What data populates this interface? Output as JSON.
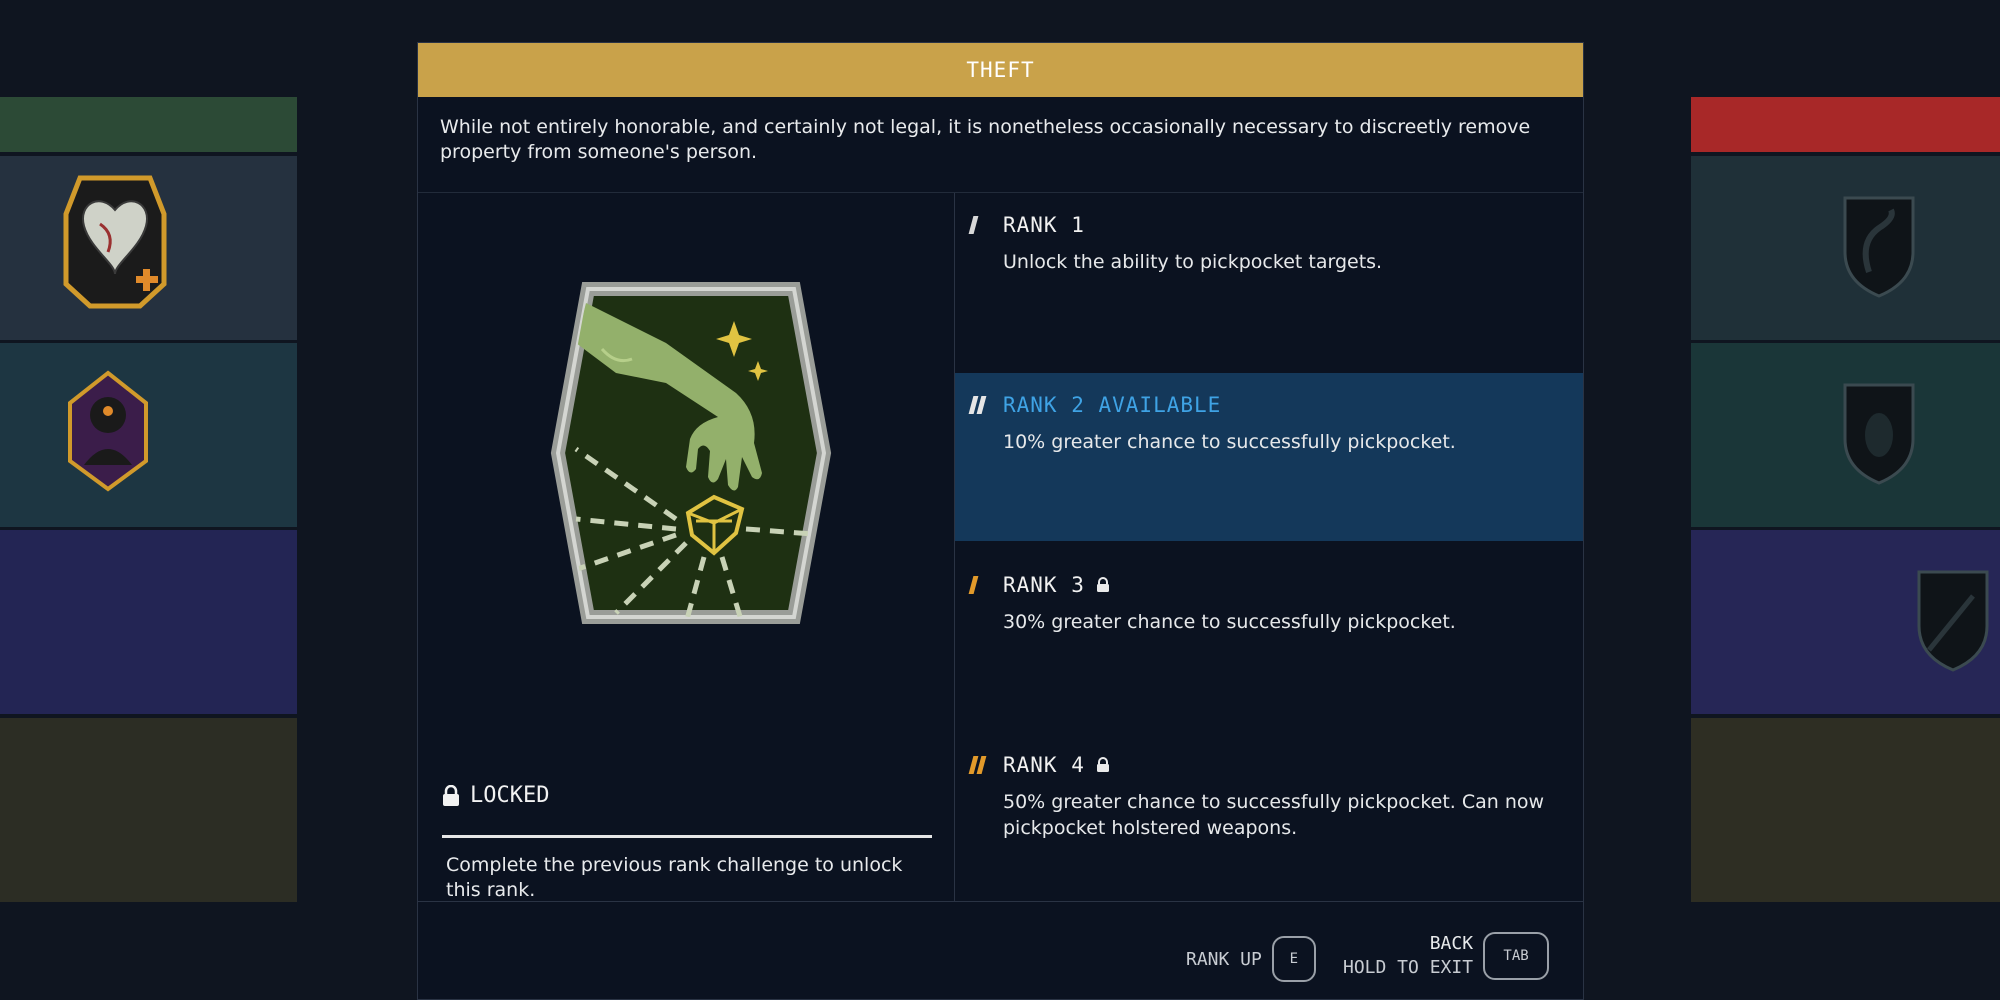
{
  "panel": {
    "title": "THEFT",
    "description": "While not entirely honorable, and certainly not legal, it is nonetheless occasionally necessary to discreetly remove property from someone's person.",
    "locked_label": "LOCKED",
    "locked_description": "Complete the previous rank challenge to unlock this rank.",
    "accent_color": "#c9a24a"
  },
  "ranks": [
    {
      "title": "RANK 1",
      "description": "Unlock the ability to pickpocket targets.",
      "locked": false,
      "mark_color": "#d8d8d8"
    },
    {
      "title": "RANK 2 AVAILABLE",
      "description": "10% greater chance to successfully pickpocket.",
      "locked": false,
      "mark_color": "#e6e6e6"
    },
    {
      "title": "RANK 3",
      "description": "30% greater chance to successfully pickpocket.",
      "locked": true,
      "mark_color": "#e39a2a"
    },
    {
      "title": "RANK 4",
      "description": "50% greater chance to successfully pickpocket. Can now pickpocket holstered weapons.",
      "locked": true,
      "mark_color": "#e39a2a"
    }
  ],
  "footer": {
    "rank_up_label": "RANK UP",
    "rank_up_key": "E",
    "back_label": "BACK",
    "hold_label": "HOLD TO EXIT",
    "back_key": "TAB"
  },
  "icons": {
    "patch": "theft-hand-gem-patch-icon",
    "lock": "lock-icon",
    "left_cards": [
      "heart-medical-icon",
      "hooded-figure-icon"
    ],
    "right_cards": [
      "shield-dragon-icon",
      "shield-egg-icon",
      "shield-weapon-icon"
    ]
  }
}
